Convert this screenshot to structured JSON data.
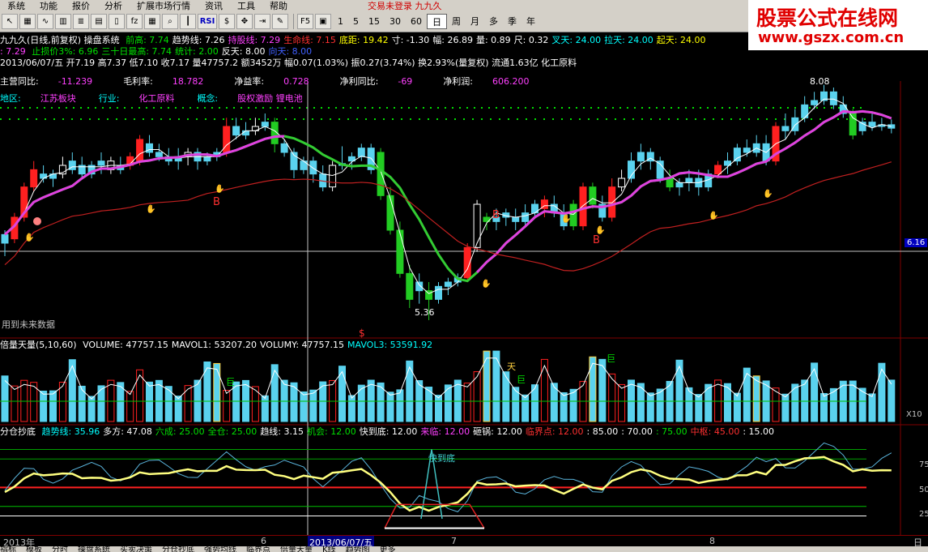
{
  "menu": [
    "系统",
    "功能",
    "报价",
    "分析",
    "扩展市场行情",
    "资讯",
    "工具",
    "帮助"
  ],
  "status": "交易未登录  九九久",
  "logo": {
    "line1": "股票公式在线网",
    "line2": "www.gszx.com.cn"
  },
  "toolbar": {
    "rsi": "RSI",
    "periods": [
      "1",
      "5",
      "15",
      "30",
      "60",
      "日",
      "周",
      "月",
      "多",
      "季",
      "年"
    ],
    "active_period": "日"
  },
  "info1": {
    "name": "九九久(日线,前复权) 操盘系统",
    "items": [
      {
        "label": "前高:",
        "value": "7.74",
        "c": "grn"
      },
      {
        "label": "趋势线:",
        "value": "7.26",
        "c": "wht"
      },
      {
        "label": "持股线:",
        "value": "7.29",
        "c": "mag"
      },
      {
        "label": "生命线:",
        "value": "7.15",
        "c": "red"
      },
      {
        "label": "底距:",
        "value": "19.42",
        "c": "yel"
      },
      {
        "label": "寸:",
        "value": "-1.30",
        "c": "wht"
      },
      {
        "label": "幅:",
        "value": "26.89",
        "c": "wht"
      },
      {
        "label": "量:",
        "value": "0.89",
        "c": "wht"
      },
      {
        "label": "尺:",
        "value": "0.32",
        "c": "wht"
      },
      {
        "label": "叉天:",
        "value": "24.00",
        "c": "cyn"
      },
      {
        "label": "拉天:",
        "value": "24.00",
        "c": "cyn"
      },
      {
        "label": "起天:",
        "value": "24.00",
        "c": "yel"
      }
    ]
  },
  "info2": {
    "lead": ": 7.29",
    "items": [
      {
        "label": "止损价3%:",
        "value": "6.96",
        "c": "grn"
      },
      {
        "label": "三十日最高:",
        "value": "7.74",
        "c": "grn"
      },
      {
        "label": "统计:",
        "value": "2.00",
        "c": "grn"
      },
      {
        "label": "反天:",
        "value": "8.00",
        "c": "wht"
      },
      {
        "label": "向天:",
        "value": "8.00",
        "c": "blu"
      }
    ]
  },
  "info3": "2013/06/07/五 开7.19 高7.37 低7.10 收7.17 量47757.2 额3452万 幅0.07(1.03%) 振0.27(3.74%) 换2.93%(量复权) 流通1.63亿 化工原料",
  "fund1": [
    {
      "label": "主营同比:",
      "value": "-11.239"
    },
    {
      "label": "毛利率:",
      "value": "18.782"
    },
    {
      "label": "净益率:",
      "value": "0.728"
    },
    {
      "label": "净利同比:",
      "value": "-69"
    },
    {
      "label": "净利润:",
      "value": "606.200"
    }
  ],
  "fund2": [
    {
      "label": "地区:",
      "value": "江苏板块"
    },
    {
      "label": "行业:",
      "value": "化工原料"
    },
    {
      "label": "概念:",
      "value": "股权激励 锂电池"
    }
  ],
  "chart_labels": {
    "high": "8.08",
    "low": "5.36",
    "future": "用到未来数据",
    "price_tag": "6.16",
    "s": "$"
  },
  "volume_header": {
    "name": "倍量天量(5,10,60)",
    "items": [
      {
        "label": "VOLUME:",
        "value": "47757.15",
        "c": "wht"
      },
      {
        "label": "MAVOL1:",
        "value": "53207.20",
        "c": "wht"
      },
      {
        "label": "VOLUMY:",
        "value": "47757.15",
        "c": "wht"
      },
      {
        "label": "MAVOL3:",
        "value": "53591.92",
        "c": "cyn"
      }
    ],
    "tags": {
      "ju": "巨",
      "tian": "天"
    },
    "unit": "X10"
  },
  "ind_header": {
    "name": "分仓抄底",
    "items": [
      {
        "label": "趋势线:",
        "value": "35.96",
        "c": "cyn"
      },
      {
        "label": "多方:",
        "value": "47.08",
        "c": "wht"
      },
      {
        "label": "六成:",
        "value": "25.00",
        "c": "grn"
      },
      {
        "label": "全仓:",
        "value": "25.00",
        "c": "grn"
      },
      {
        "label": "趋线:",
        "value": "3.15",
        "c": "wht"
      },
      {
        "label": "机会:",
        "value": "12.00",
        "c": "grn"
      },
      {
        "label": "快到底:",
        "value": "12.00",
        "c": "wht"
      },
      {
        "label": "来临:",
        "value": "12.00",
        "c": "mag"
      },
      {
        "label": "砸锅:",
        "value": "12.00",
        "c": "wht"
      },
      {
        "label": "临界点:",
        "value": "12.00",
        "c": "red"
      },
      {
        "label": ":",
        "value": "85.00",
        "c": "wht"
      },
      {
        "label": ":",
        "value": "70.00",
        "c": "wht"
      },
      {
        "label": ":",
        "value": "75.00",
        "c": "grn"
      },
      {
        "label": "中枢:",
        "value": "45.00",
        "c": "red"
      },
      {
        "label": ":",
        "value": "15.00",
        "c": "wht"
      }
    ],
    "tag": "快到底",
    "levels": [
      "75",
      "50",
      "25"
    ]
  },
  "axis": {
    "year": "2013年",
    "m6": "6",
    "cursor": "2013/06/07/五",
    "m7": "7",
    "m8": "8",
    "corner": "日线"
  },
  "tabs": [
    "指标",
    "模板",
    "分时",
    "操盘系统",
    "买卖决策",
    "分仓抄底",
    "强势均线",
    "临界点",
    "倍量天量",
    "K线",
    "趋势图",
    "更多"
  ]
}
